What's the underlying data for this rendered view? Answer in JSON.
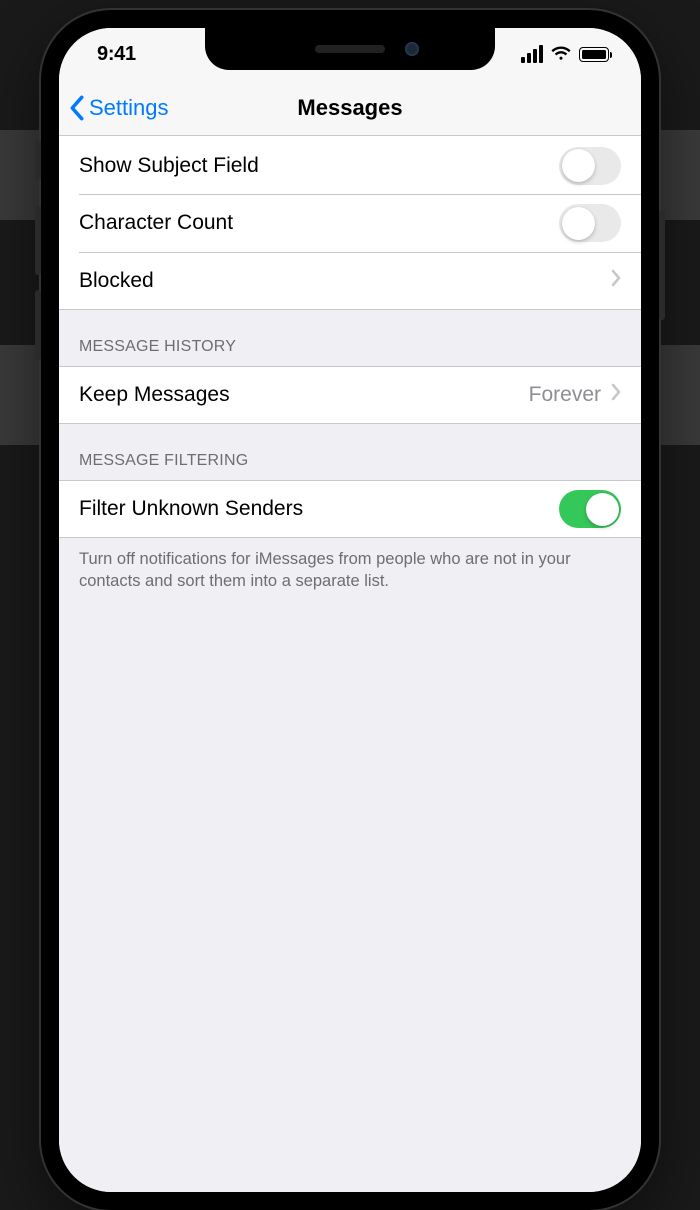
{
  "status": {
    "time": "9:41"
  },
  "nav": {
    "back_label": "Settings",
    "title": "Messages"
  },
  "section1": {
    "rows": [
      {
        "label": "Show Subject Field",
        "type": "toggle",
        "on": false
      },
      {
        "label": "Character Count",
        "type": "toggle",
        "on": false
      },
      {
        "label": "Blocked",
        "type": "disclosure"
      }
    ]
  },
  "section2": {
    "header": "MESSAGE HISTORY",
    "rows": [
      {
        "label": "Keep Messages",
        "value": "Forever",
        "type": "disclosure"
      }
    ]
  },
  "section3": {
    "header": "MESSAGE FILTERING",
    "rows": [
      {
        "label": "Filter Unknown Senders",
        "type": "toggle",
        "on": true
      }
    ],
    "footer": "Turn off notifications for iMessages from people who are not in your contacts and sort them into a separate list."
  }
}
